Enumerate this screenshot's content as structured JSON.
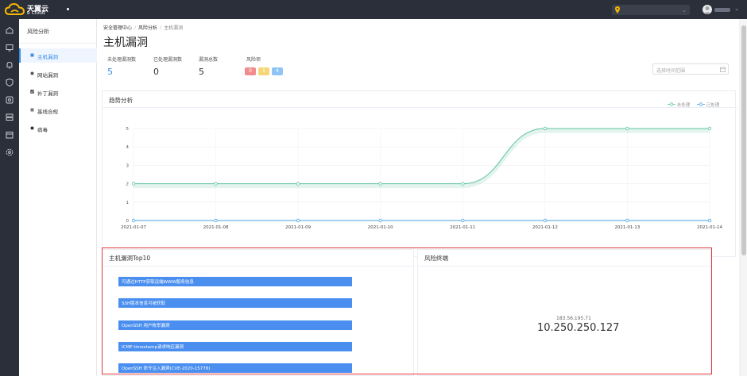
{
  "brand": {
    "title": "天翼云",
    "subtitle": "e Cloud"
  },
  "colors": {
    "accent": "#3a8ee6",
    "unprocessed": "#5ec49c",
    "processed": "#4aa3e0",
    "risk_high": "#f08c8c",
    "risk_mid": "#f5d77a",
    "risk_low": "#8ec5f5",
    "highlight": "#e23a3a"
  },
  "sidebar": {
    "title": "风险分析",
    "items": [
      {
        "label": "主机漏洞",
        "icon": "host-icon",
        "active": true
      },
      {
        "label": "网站漏洞",
        "icon": "globe-icon",
        "active": false
      },
      {
        "label": "补丁漏洞",
        "icon": "checkbox-icon",
        "active": false
      },
      {
        "label": "基线合规",
        "icon": "list-icon",
        "active": false
      },
      {
        "label": "病毒",
        "icon": "bug-icon",
        "active": false
      }
    ]
  },
  "rail": {
    "icons": [
      "home-icon",
      "monitor-icon",
      "bell-icon",
      "shield-icon",
      "gear-icon",
      "database-icon",
      "calendar-icon",
      "settings-icon"
    ]
  },
  "breadcrumb": [
    "安全管理中心",
    "风险分析",
    "主机漏洞"
  ],
  "page_title": "主机漏洞",
  "stats": [
    {
      "label": "未处理漏洞数",
      "value": "5"
    },
    {
      "label": "已处理漏洞数",
      "value": "0"
    },
    {
      "label": "漏洞总数",
      "value": "5"
    }
  ],
  "risk": {
    "label": "风险项",
    "high": "0",
    "mid": "1",
    "low": "4"
  },
  "date_range": {
    "placeholder": "选择时间范围"
  },
  "trend": {
    "title": "趋势分析",
    "legend": [
      "未处理",
      "已处理"
    ]
  },
  "chart_data": {
    "type": "line",
    "title": "趋势分析",
    "x": [
      "2021-01-07",
      "2021-01-08",
      "2021-01-09",
      "2021-01-10",
      "2021-01-11",
      "2021-01-12",
      "2021-01-13",
      "2021-01-14"
    ],
    "yticks": [
      "0",
      "1",
      "2",
      "3",
      "4",
      "5"
    ],
    "ylim": [
      0,
      5
    ],
    "grid": true,
    "legend_position": "top-right",
    "series": [
      {
        "name": "未处理",
        "values": [
          2,
          2,
          2,
          2,
          2,
          5,
          5,
          5
        ]
      },
      {
        "name": "已处理",
        "values": [
          0,
          0,
          0,
          0,
          0,
          0,
          0,
          0
        ]
      }
    ]
  },
  "top10": {
    "title": "主机漏洞Top10",
    "items": [
      "可通过HTTP获取远端WWW服务信息",
      "SSH版本信息可被获取",
      "OpenSSH 用户枚举漏洞",
      "ICMP timestamp请求响应漏洞",
      "OpenSSH 命令注入漏洞(CVE-2020-15778)"
    ]
  },
  "terminal": {
    "title": "风险终端",
    "ip_small": "183.56.195.71",
    "ip_big": "10.250.250.127"
  }
}
